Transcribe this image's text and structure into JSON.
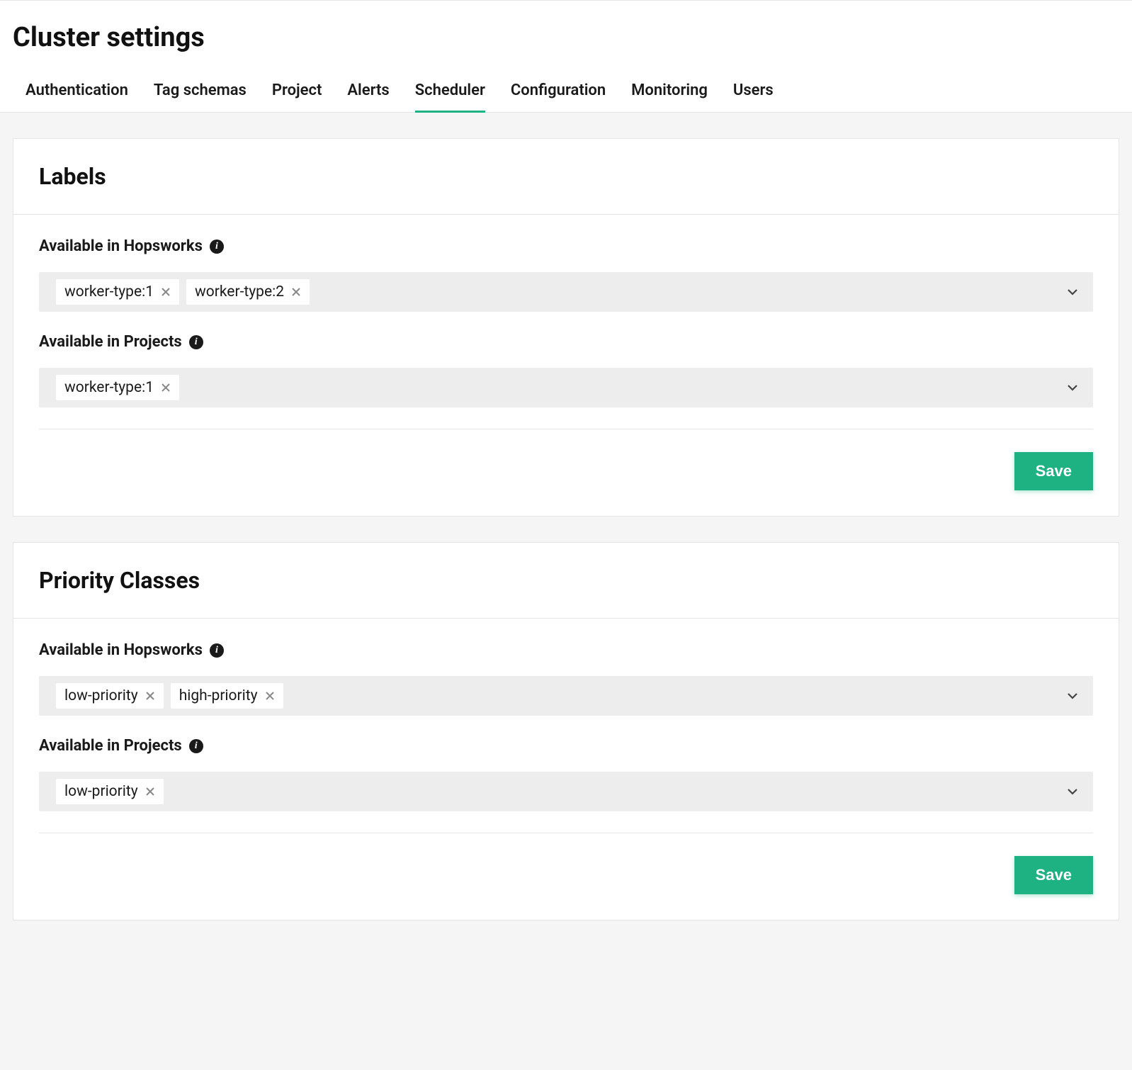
{
  "page": {
    "title": "Cluster settings"
  },
  "tabs": [
    {
      "label": "Authentication",
      "active": false
    },
    {
      "label": "Tag schemas",
      "active": false
    },
    {
      "label": "Project",
      "active": false
    },
    {
      "label": "Alerts",
      "active": false
    },
    {
      "label": "Scheduler",
      "active": true
    },
    {
      "label": "Configuration",
      "active": false
    },
    {
      "label": "Monitoring",
      "active": false
    },
    {
      "label": "Users",
      "active": false
    }
  ],
  "sections": {
    "labels": {
      "title": "Labels",
      "hopsworks_label": "Available in Hopsworks",
      "hopsworks_chips": [
        "worker-type:1",
        "worker-type:2"
      ],
      "projects_label": "Available in Projects",
      "projects_chips": [
        "worker-type:1"
      ],
      "save_label": "Save"
    },
    "priority": {
      "title": "Priority Classes",
      "hopsworks_label": "Available in Hopsworks",
      "hopsworks_chips": [
        "low-priority",
        "high-priority"
      ],
      "projects_label": "Available in Projects",
      "projects_chips": [
        "low-priority"
      ],
      "save_label": "Save"
    }
  }
}
